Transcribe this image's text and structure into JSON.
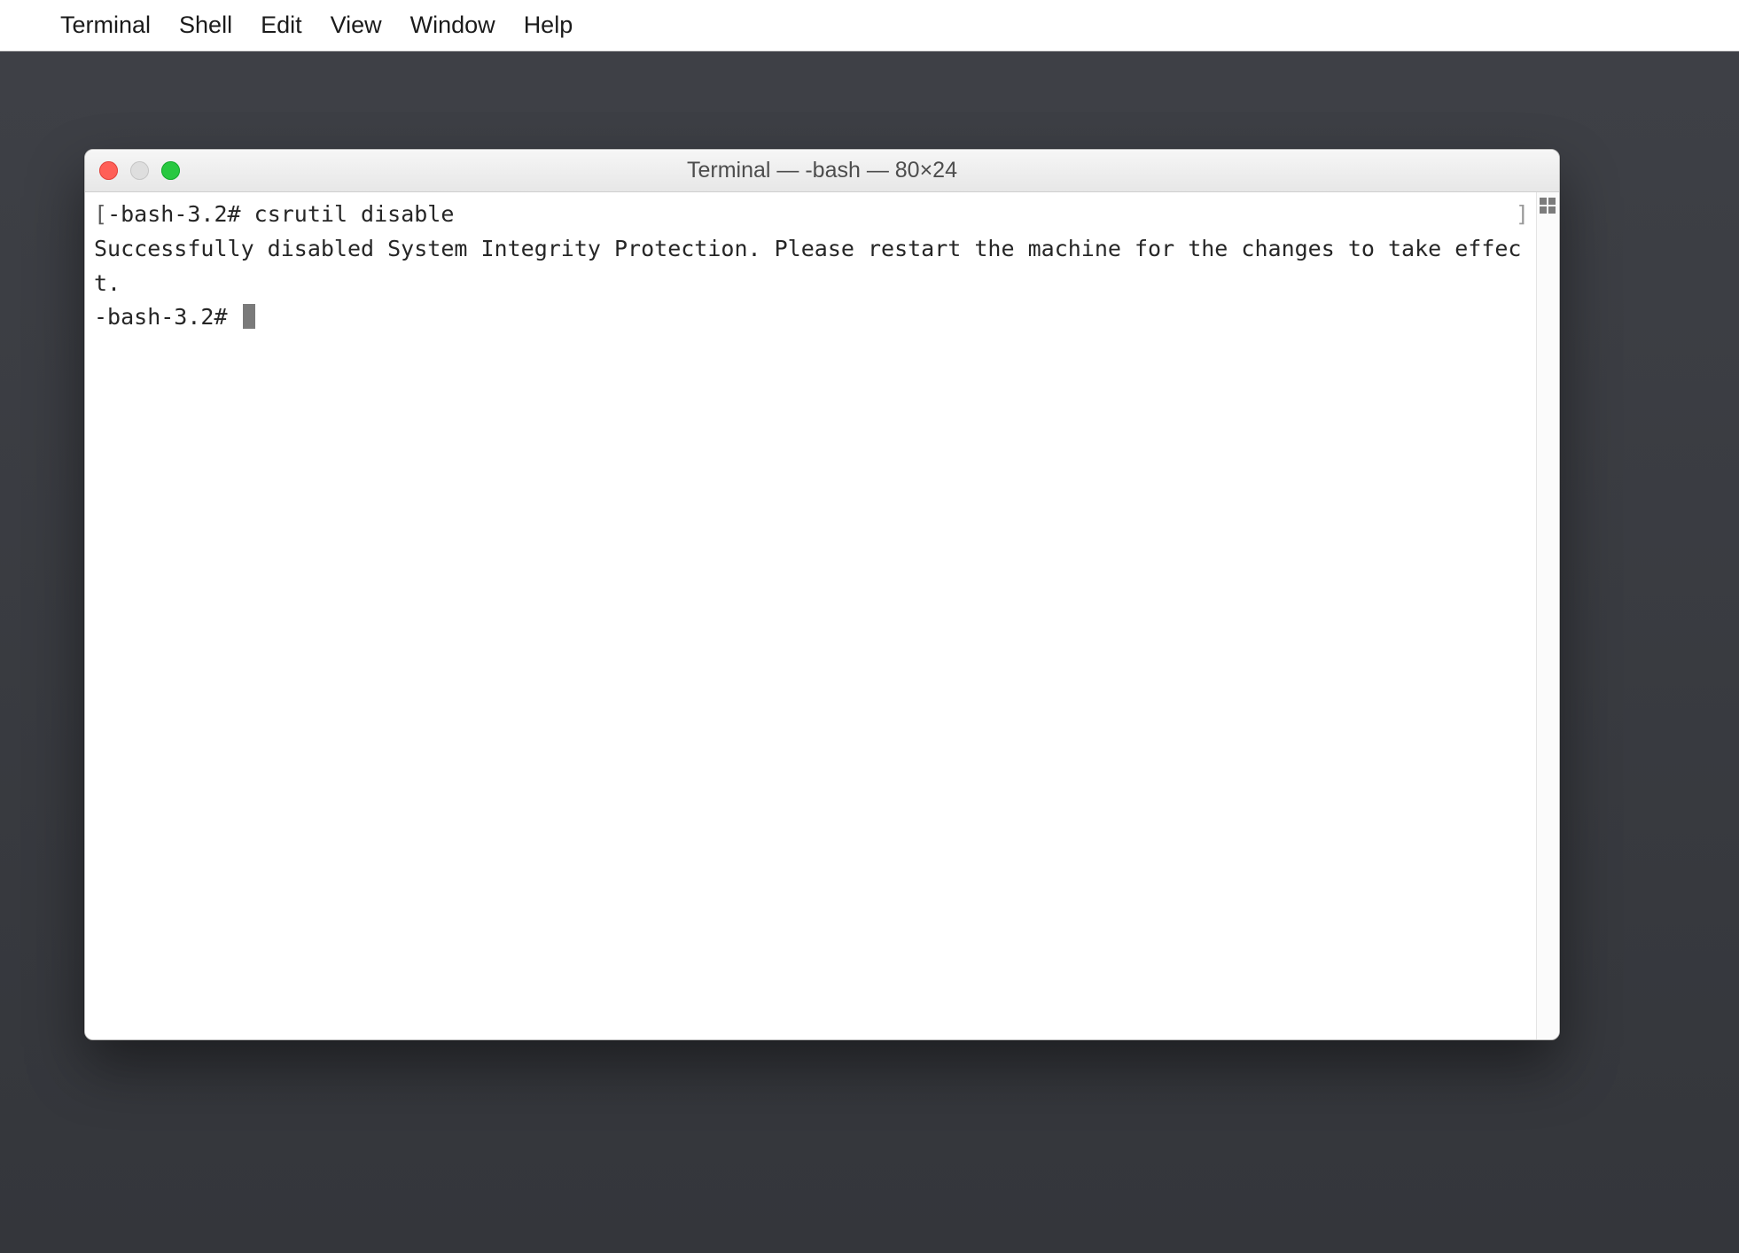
{
  "menubar": {
    "app": "Terminal",
    "items": [
      "Shell",
      "Edit",
      "View",
      "Window",
      "Help"
    ]
  },
  "window": {
    "title": "Terminal — -bash — 80×24"
  },
  "terminal": {
    "line1_bracket": "[",
    "line1_prompt": "-bash-3.2# ",
    "line1_command": "csrutil disable",
    "line1_close": "]",
    "line2": "Successfully disabled System Integrity Protection. Please restart the machine for the changes to take effect.",
    "line3_prompt": "-bash-3.2# "
  }
}
